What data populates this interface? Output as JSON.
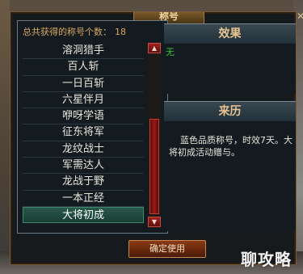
{
  "window": {
    "title": "称号",
    "close_symbol": "✕"
  },
  "left_panel": {
    "count_label": "总共获得的称号个数：",
    "count_value": "18",
    "items": [
      "溶洞猎手",
      "百人斩",
      "一日百斩",
      "六星伴月",
      "咿呀学语",
      "征东将军",
      "龙纹战士",
      "军需达人",
      "龙战于野",
      "一本正经",
      "大将初成"
    ],
    "selected_index": 10
  },
  "effect": {
    "header": "效果",
    "text": "无"
  },
  "source": {
    "header": "来历",
    "text": "蓝色品质称号，时效7天。大将初成活动赠与。"
  },
  "confirm_button": "确定使用",
  "watermark": "聊攻略",
  "colors": {
    "accent_orange": "#d8a860",
    "effect_green": "#38c038",
    "header_gold": "#e8c490",
    "scroll_red": "#a01818"
  }
}
